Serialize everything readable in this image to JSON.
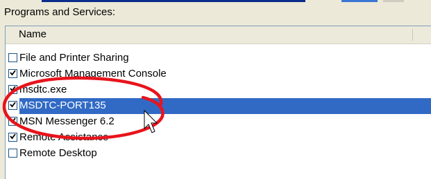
{
  "section_label": "Programs and Services:",
  "list": {
    "column_header": "Name",
    "rows": [
      {
        "label": "File and Printer Sharing",
        "checked": false,
        "selected": false
      },
      {
        "label": "Microsoft Management Console",
        "checked": true,
        "selected": false
      },
      {
        "label": "msdtc.exe",
        "checked": true,
        "selected": false
      },
      {
        "label": "MSDTC-PORT135",
        "checked": true,
        "selected": true
      },
      {
        "label": "MSN Messenger 6.2",
        "checked": true,
        "selected": false
      },
      {
        "label": "Remote Assistance",
        "checked": true,
        "selected": false
      },
      {
        "label": "Remote Desktop",
        "checked": false,
        "selected": false
      }
    ]
  },
  "colors": {
    "selection": "#316AC5",
    "annotation": "#E8141C",
    "window_background": "#ECE9D8"
  }
}
